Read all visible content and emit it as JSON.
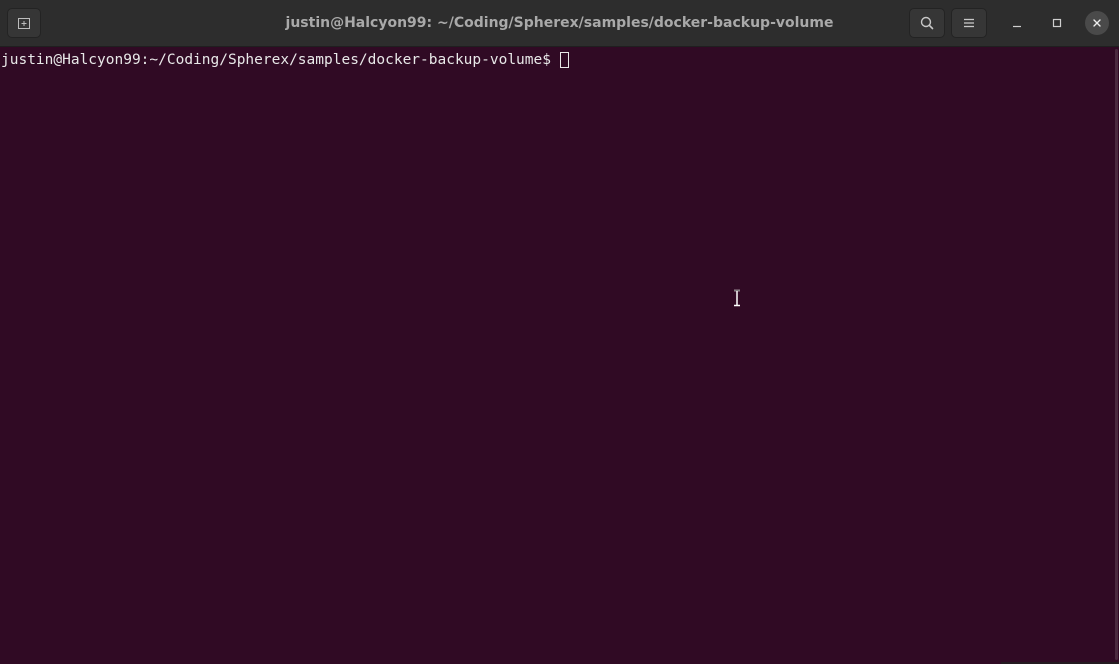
{
  "window": {
    "title": "justin@Halcyon99: ~/Coding/Spherex/samples/docker-backup-volume"
  },
  "toolbar": {
    "new_tab_icon": "new-tab-icon",
    "search_icon": "search-icon",
    "menu_icon": "hamburger-menu-icon",
    "minimize_icon": "minimize-icon",
    "maximize_icon": "maximize-icon",
    "close_icon": "close-icon"
  },
  "terminal": {
    "prompt": "justin@Halcyon99:~/Coding/Spherex/samples/docker-backup-volume$",
    "input": ""
  },
  "colors": {
    "background": "#300a24",
    "titlebar": "#2d2d2d",
    "foreground": "#e8e8e8",
    "title_text": "#a9a9a9"
  }
}
